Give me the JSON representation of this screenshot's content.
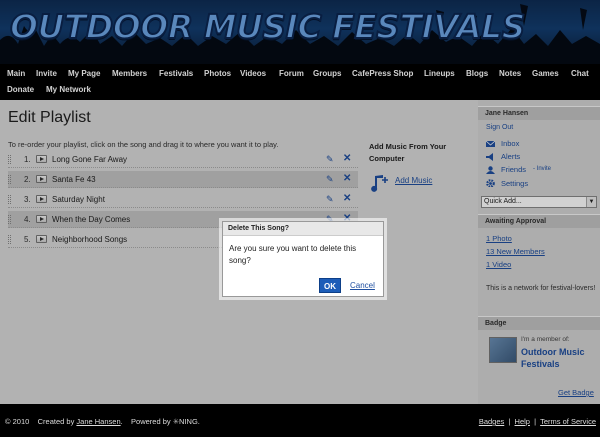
{
  "site": {
    "title": "OUTDOOR MUSIC FESTIVALS"
  },
  "nav": {
    "items": [
      "Main",
      "Invite",
      "My Page",
      "Members",
      "Festivals",
      "Photos",
      "Videos",
      "Forum",
      "Groups",
      "CafePress Shop",
      "Lineups",
      "Blogs",
      "Notes",
      "Games",
      "Chat",
      "Donate",
      "My Network"
    ]
  },
  "main": {
    "title": "Edit Playlist",
    "instructions": "To re-order your playlist, click on the song and drag it to where you want it to play.",
    "songs": [
      {
        "num": "1.",
        "title": "Long Gone Far Away"
      },
      {
        "num": "2.",
        "title": "Santa Fe 43"
      },
      {
        "num": "3.",
        "title": "Saturday Night"
      },
      {
        "num": "4.",
        "title": "When the Day Comes"
      },
      {
        "num": "5.",
        "title": "Neighborhood Songs"
      }
    ],
    "add_music_heading": "Add Music From Your Computer",
    "add_music_link": "Add Music"
  },
  "sidebar": {
    "user_name": "Jane Hansen",
    "sign_out": "Sign Out",
    "inbox": "Inbox",
    "alerts": "Alerts",
    "friends": "Friends",
    "invite": "- Invite",
    "settings": "Settings",
    "quick_add": "Quick Add...",
    "awaiting_heading": "Awaiting Approval",
    "awaiting_photo": "1 Photo",
    "awaiting_members": "13 New Members",
    "awaiting_video": "1 Video",
    "network_desc": "This is a network for festival-lovers!",
    "badge_heading": "Badge",
    "badge_member_text": "I'm a member of:",
    "badge_network_name": "Outdoor Music Festivals",
    "get_badge": "Get Badge"
  },
  "dialog": {
    "title": "Delete This Song?",
    "message": "Are you sure you want to delete this song?",
    "ok": "OK",
    "cancel": "Cancel"
  },
  "footer": {
    "copyright": "© 2010",
    "created_by": "Created by",
    "creator": "Jane Hansen",
    "powered_by": "Powered by",
    "ning": "NING.",
    "badges": "Badges",
    "help": "Help",
    "terms": "Terms of Service"
  },
  "colors": {
    "link": "#1f4fa0",
    "ok_button": "#1d5db8",
    "banner_text": "#6ea6e6"
  }
}
